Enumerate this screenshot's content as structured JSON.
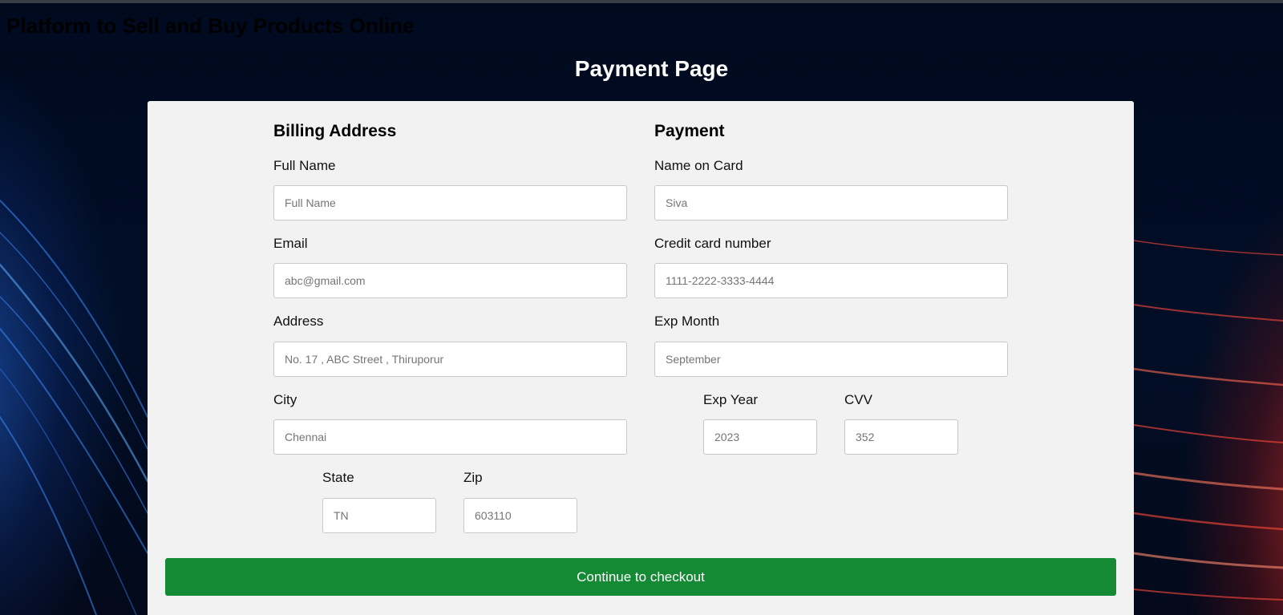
{
  "header": {
    "site_title": "Platform to Sell and Buy Products Online",
    "page_title": "Payment Page"
  },
  "billing": {
    "heading": "Billing Address",
    "full_name": {
      "label": "Full Name",
      "placeholder": "Full Name"
    },
    "email": {
      "label": "Email",
      "placeholder": "abc@gmail.com"
    },
    "address": {
      "label": "Address",
      "placeholder": "No. 17 , ABC Street , Thiruporur"
    },
    "city": {
      "label": "City",
      "placeholder": "Chennai"
    },
    "state": {
      "label": "State",
      "placeholder": "TN"
    },
    "zip": {
      "label": "Zip",
      "placeholder": "603110"
    }
  },
  "payment": {
    "heading": "Payment",
    "name_on_card": {
      "label": "Name on Card",
      "placeholder": "Siva"
    },
    "card_number": {
      "label": "Credit card number",
      "placeholder": "1111-2222-3333-4444"
    },
    "exp_month": {
      "label": "Exp Month",
      "placeholder": "September"
    },
    "exp_year": {
      "label": "Exp Year",
      "placeholder": "2023"
    },
    "cvv": {
      "label": "CVV",
      "placeholder": "352"
    }
  },
  "actions": {
    "checkout_label": "Continue to checkout"
  },
  "colors": {
    "checkout_button": "#138a33",
    "card_background": "#f2f2f2",
    "page_background": "#000a1f"
  }
}
